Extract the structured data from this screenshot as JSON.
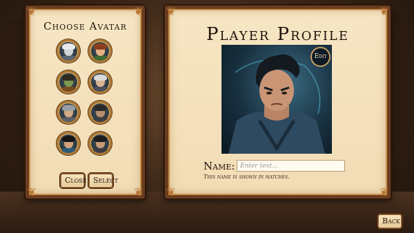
{
  "avatar_picker": {
    "title": "Choose Avatar",
    "avatars": [
      {
        "name": "pale-knight",
        "skin": "#cfd3d6",
        "hair": "#e8eaec",
        "body": "#5d6670"
      },
      {
        "name": "elf-ranger",
        "skin": "#e3b184",
        "hair": "#8a3f1c",
        "body": "#3f6a36"
      },
      {
        "name": "orc-warrior",
        "skin": "#7a9a52",
        "hair": "#2d2a22",
        "body": "#7a4a24"
      },
      {
        "name": "old-mage",
        "skin": "#d7b393",
        "hair": "#d9d9d9",
        "body": "#4c4f5c"
      },
      {
        "name": "bearded-elder",
        "skin": "#d5a983",
        "hair": "#9a9fa6",
        "body": "#5a5f68"
      },
      {
        "name": "dark-knight",
        "skin": "#b98e6e",
        "hair": "#2a2a2a",
        "body": "#3c3e44"
      },
      {
        "name": "young-rogue",
        "skin": "#d1a07c",
        "hair": "#151515",
        "body": "#2c5a78"
      },
      {
        "name": "stern-captain",
        "skin": "#c79a78",
        "hair": "#1c1c1c",
        "body": "#3a3d46"
      }
    ],
    "close_label": "Close",
    "select_label": "Select"
  },
  "profile": {
    "title": "Player Profile",
    "edit_label": "Edit",
    "name_label": "Name:",
    "name_value": "",
    "name_placeholder": "Enter text...",
    "hint": "This name is shown in matches."
  },
  "back_label": "Back",
  "colors": {
    "parchment": "#f4e2bd",
    "frame": "#6b3d1f",
    "gold_trim": "#c9934a",
    "ink": "#1e120a"
  }
}
